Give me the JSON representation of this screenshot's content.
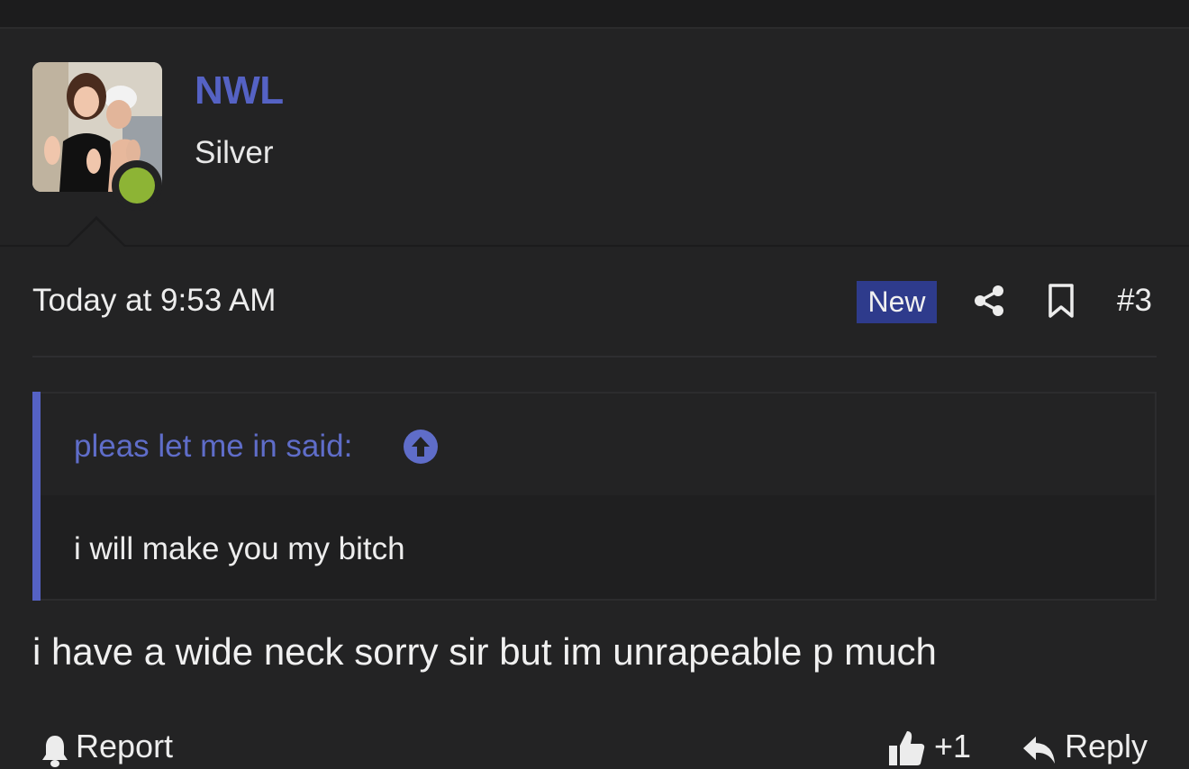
{
  "post": {
    "author": {
      "username": "NWL",
      "user_title": "Silver",
      "online_status": "online",
      "status_color": "#8db435"
    },
    "date": "Today at 9:53 AM",
    "new_badge": "New",
    "post_number": "#3",
    "quote": {
      "author_line": "pleas let me in said:",
      "text": "i will make you my bitch"
    },
    "body": "i have a wide neck sorry sir but im unrapeable p much",
    "actions": {
      "report_label": "Report",
      "like_label": "+1",
      "reply_label": "Reply"
    }
  },
  "icons": {
    "share": "share-icon",
    "bookmark": "bookmark-icon",
    "quote_jump": "arrow-up-circle-icon",
    "report": "bell-icon",
    "like": "thumbs-up-icon",
    "reply": "reply-arrow-icon"
  },
  "colors": {
    "accent": "#5562c4",
    "badge_bg": "#2e3b8c",
    "background": "#232324"
  }
}
